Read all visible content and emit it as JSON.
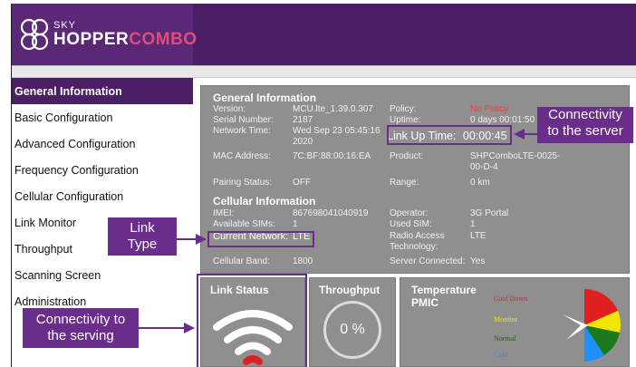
{
  "brand": {
    "line1": "SKY",
    "line2a": "HOPPER",
    "line2b": "COMBO",
    "colors": {
      "header": "#4a1f63",
      "accent": "#6a2d8c",
      "panel": "#8f8f8f",
      "highlight_red": "#e02020"
    }
  },
  "sidebar": {
    "items": [
      {
        "label": "General Information",
        "active": true
      },
      {
        "label": "Basic Configuration"
      },
      {
        "label": "Advanced Configuration"
      },
      {
        "label": "Frequency Configuration"
      },
      {
        "label": "Cellular Configuration"
      },
      {
        "label": "Link Monitor"
      },
      {
        "label": "Throughput"
      },
      {
        "label": "Scanning Screen"
      },
      {
        "label": "Administration"
      }
    ]
  },
  "general": {
    "title": "General Information",
    "version_label": "Version:",
    "version": "MCU.lte_1.39.0.307",
    "policy_label": "Policy:",
    "policy": "No Policy",
    "serial_label": "Serial Number:",
    "serial": "2187",
    "uptime_label": "Uptime:",
    "uptime": "0 days 00:01:50",
    "network_time_label": "Network Time:",
    "network_time_1": "Wed Sep 23 05:45:16",
    "network_time_2": "2020",
    "link_up_label": "Link Up Time:",
    "link_up": "00:00:45",
    "mac_label": "MAC Address:",
    "mac": "7C:BF:88:00:16:EA",
    "product_label": "Product:",
    "product_1": "SHPComboLTE-0025-",
    "product_2": "00-D-4",
    "pairing_label": "Pairing Status:",
    "pairing": "OFF",
    "range_label": "Range:",
    "range": "0 km"
  },
  "cellular": {
    "title": "Cellular Information",
    "imei_label": "IMEI:",
    "imei": "867698041040919",
    "operator_label": "Operator:",
    "operator": "3G Portal",
    "sims_label": "Available SIMs:",
    "sims": "1",
    "used_sim_label": "Used SIM:",
    "used_sim": "1",
    "current_network_label": "Current Network:",
    "current_network": "LTE",
    "rat_label_1": "Radio Access",
    "rat_label_2": "Technology:",
    "rat": "LTE",
    "band_label": "Cellular Band:",
    "band": "1800",
    "server_label": "Server Connected:",
    "server": "Yes"
  },
  "tiles": {
    "link_status": "Link Status",
    "throughput": "Throughput",
    "throughput_value": "0 %",
    "temperature_1": "Temperature",
    "temperature_2": "PMIC",
    "legend": {
      "cool": "Cool Down",
      "monitor": "Monitor",
      "normal": "Normal",
      "cold": "Cold"
    }
  },
  "callouts": {
    "connectivity_server_1": "Connectivity",
    "connectivity_server_2": "to the server",
    "link_type_1": "Link",
    "link_type_2": "Type",
    "connectivity_serving_1": "Connectivity to",
    "connectivity_serving_2": "the serving"
  }
}
